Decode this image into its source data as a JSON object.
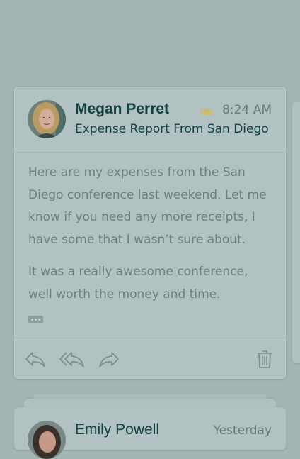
{
  "email": {
    "sender": "Megan Perret",
    "time": "8:24 AM",
    "subject": "Expense Report From San Diego",
    "has_attachment": true,
    "body": [
      "Here are my expenses from the San Diego conference last weekend. Let me know if you need any more receipts, I have some that I wasn’t sure about.",
      "It was a really awesome conference, well worth the money and time."
    ]
  },
  "actions": [
    "reply-icon",
    "reply-all-icon",
    "forward-icon",
    "trash-icon"
  ],
  "next_email": {
    "sender": "Emily Powell",
    "time": "Yesterday"
  },
  "colors": {
    "background": "#a3b4b5",
    "card": "#b2c2c3",
    "title_text": "#11413f",
    "body_text": "#6d7e7e",
    "attachment": "#d3b85a",
    "icon": "#7a8b8b"
  }
}
